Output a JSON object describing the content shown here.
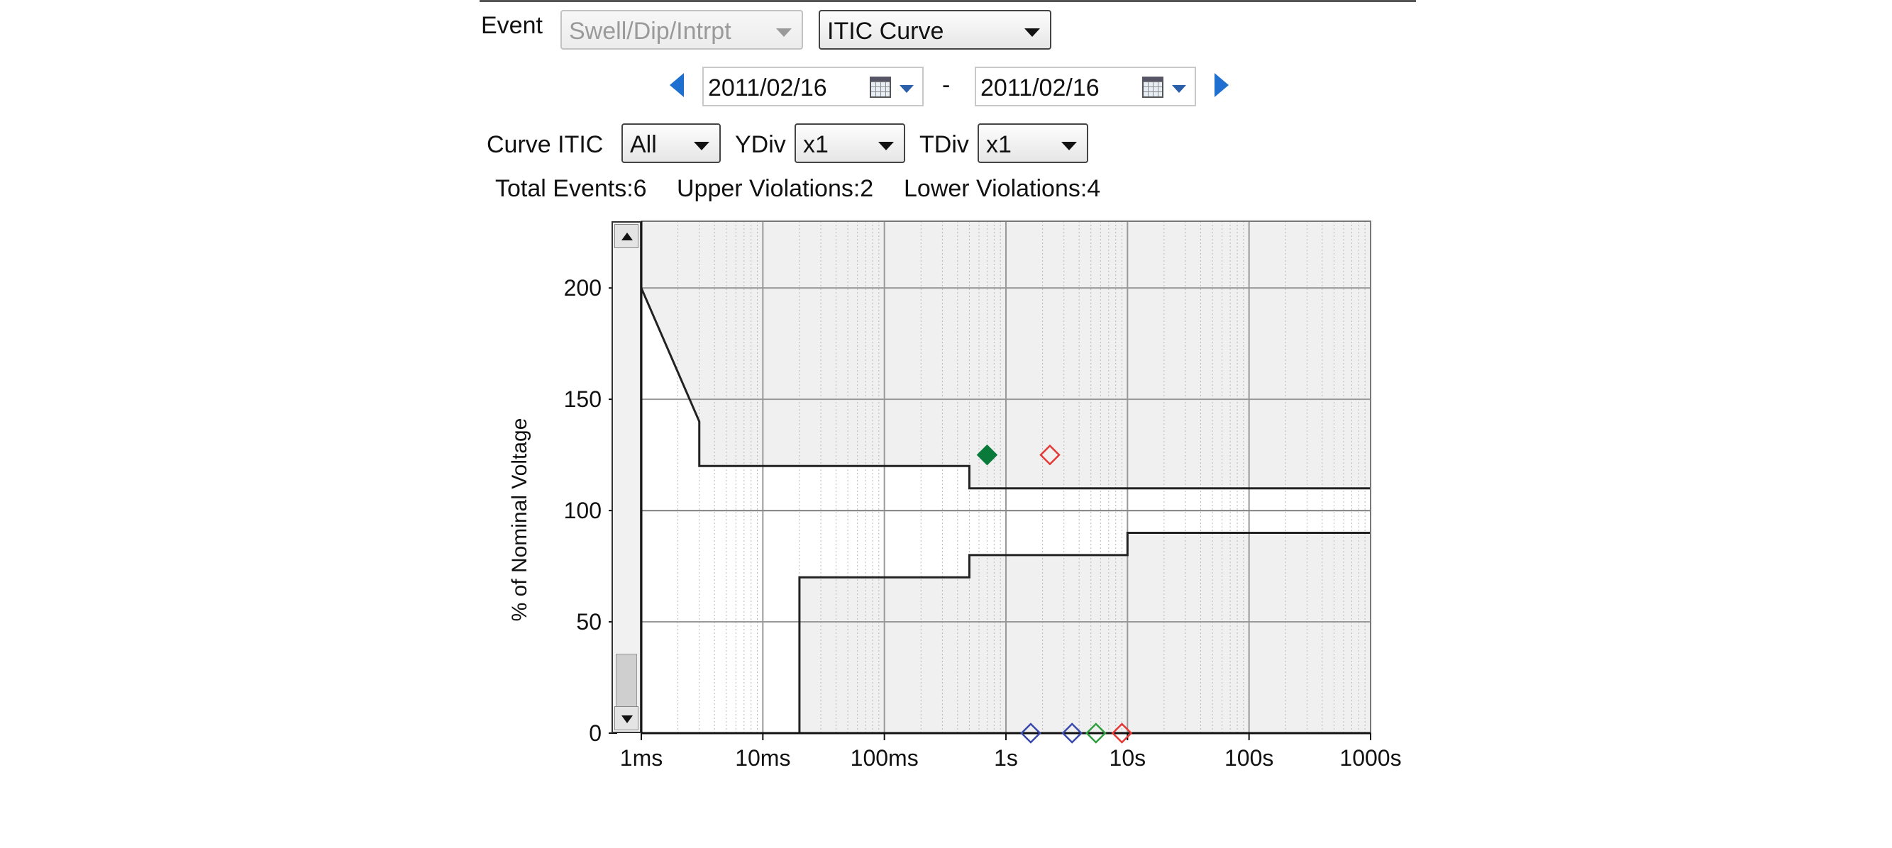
{
  "toolbar": {
    "event_label": "Event",
    "event_type": "Swell/Dip/Intrpt",
    "view_type": "ITIC Curve",
    "date_from": "2011/02/16",
    "date_separator": "-",
    "date_to": "2011/02/16",
    "curve_label": "Curve ITIC",
    "curve_value": "All",
    "ydiv_label": "YDiv",
    "ydiv_value": "x1",
    "tdiv_label": "TDiv",
    "tdiv_value": "x1"
  },
  "summary": {
    "total": "Total Events:6",
    "upper": "Upper Violations:2",
    "lower": "Lower Violations:4"
  },
  "icons": {
    "prev": "chevron-left-icon",
    "next": "chevron-right-icon",
    "calendar": "calendar-icon",
    "scroll_up": "scroll-up-icon",
    "scroll_down": "scroll-down-icon"
  },
  "chart_data": {
    "type": "scatter",
    "ylabel": "% of Nominal Voltage",
    "xscale": "log",
    "xlim": [
      0.001,
      1000
    ],
    "ylim": [
      0,
      230
    ],
    "xtick_values": [
      0.001,
      0.01,
      0.1,
      1,
      10,
      100,
      1000
    ],
    "xtick_labels": [
      "1ms",
      "10ms",
      "100ms",
      "1s",
      "10s",
      "100s",
      "1000s"
    ],
    "ytick_values": [
      0,
      50,
      100,
      150,
      200
    ],
    "ytick_labels": [
      "0",
      "50",
      "100",
      "150",
      "200"
    ],
    "grid": true,
    "upper_curve": {
      "x": [
        0.001,
        0.003,
        0.003,
        0.5,
        0.5,
        1000
      ],
      "y": [
        200,
        140,
        120,
        120,
        110,
        110
      ]
    },
    "lower_curve": {
      "x": [
        0.02,
        0.02,
        0.5,
        0.5,
        10,
        10,
        1000
      ],
      "y": [
        0,
        70,
        70,
        80,
        80,
        90,
        90
      ]
    },
    "nominal_line": 100,
    "points": [
      {
        "x": 0.7,
        "y": 125,
        "color": "#0a7a3a",
        "filled": true
      },
      {
        "x": 2.3,
        "y": 125,
        "color": "#e53935",
        "filled": false
      },
      {
        "x": 1.6,
        "y": 0,
        "color": "#3949ab",
        "filled": false
      },
      {
        "x": 3.5,
        "y": 0,
        "color": "#3949ab",
        "filled": false
      },
      {
        "x": 5.5,
        "y": 0,
        "color": "#2e9e3e",
        "filled": false
      },
      {
        "x": 9.0,
        "y": 0,
        "color": "#e53935",
        "filled": false
      }
    ]
  }
}
